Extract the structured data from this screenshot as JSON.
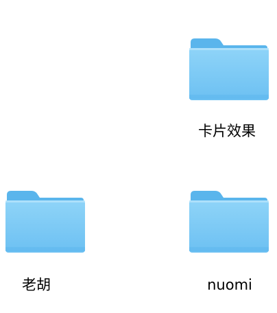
{
  "desktop": {
    "folders": [
      {
        "label": "卡片效果",
        "icon": "folder-icon"
      },
      {
        "label": "老胡",
        "icon": "folder-icon"
      },
      {
        "label": "nuomi",
        "icon": "folder-icon"
      }
    ]
  },
  "colors": {
    "folder_light": "#8fd0f7",
    "folder_main": "#71c4f3",
    "folder_dark": "#4fb0ea",
    "label_text": "#000000"
  }
}
